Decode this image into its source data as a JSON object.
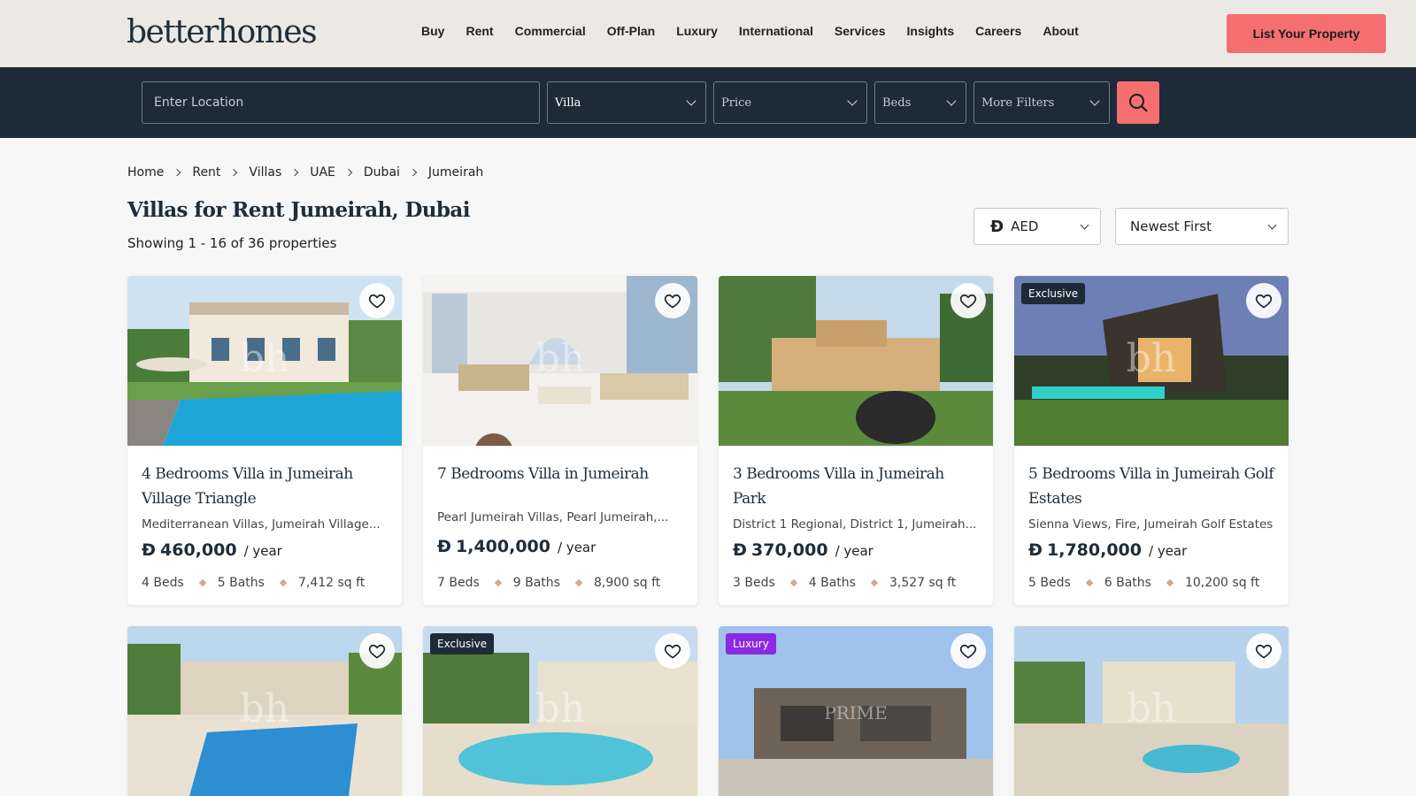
{
  "header": {
    "logo": "betterhomes",
    "nav": [
      "Buy",
      "Rent",
      "Commercial",
      "Off-Plan",
      "Luxury",
      "International",
      "Services",
      "Insights",
      "Careers",
      "About"
    ],
    "cta": "List Your Property"
  },
  "search": {
    "location_placeholder": "Enter Location",
    "type": "Villa",
    "price": "Price",
    "beds": "Beds",
    "more": "More Filters"
  },
  "breadcrumb": [
    "Home",
    "Rent",
    "Villas",
    "UAE",
    "Dubai",
    "Jumeirah"
  ],
  "listing": {
    "title": "Villas for Rent Jumeirah, Dubai",
    "count": "Showing 1 - 16 of 36 properties",
    "currency": "AED",
    "currency_symbol": "Đ",
    "sort": "Newest First"
  },
  "cards": [
    {
      "title": "4 Bedrooms Villa in Jumeirah Village Triangle",
      "location": "Mediterranean Villas, Jumeirah Village...",
      "price": "460,000",
      "per": "/ year",
      "beds": "4 Beds",
      "baths": "5 Baths",
      "area": "7,412 sq ft",
      "badge": "",
      "watermark": "bh"
    },
    {
      "title": "7 Bedrooms Villa in Jumeirah",
      "location": "Pearl Jumeirah Villas, Pearl Jumeirah,...",
      "price": "1,400,000",
      "per": "/ year",
      "beds": "7 Beds",
      "baths": "9 Baths",
      "area": "8,900 sq ft",
      "badge": "",
      "watermark": "bh"
    },
    {
      "title": "3 Bedrooms Villa in Jumeirah Park",
      "location": "District 1 Regional, District 1, Jumeirah...",
      "price": "370,000",
      "per": "/ year",
      "beds": "3 Beds",
      "baths": "4 Baths",
      "area": "3,527 sq ft",
      "badge": "",
      "watermark": ""
    },
    {
      "title": "5 Bedrooms Villa in Jumeirah Golf Estates",
      "location": "Sienna Views, Fire, Jumeirah Golf Estates",
      "price": "1,780,000",
      "per": "/ year",
      "beds": "5 Beds",
      "baths": "6 Baths",
      "area": "10,200 sq ft",
      "badge": "Exclusive",
      "watermark": "bh"
    },
    {
      "badge": "",
      "watermark": "bh"
    },
    {
      "badge": "Exclusive",
      "watermark": "bh"
    },
    {
      "badge": "Luxury",
      "watermark": "PRIME"
    },
    {
      "badge": "",
      "watermark": "bh"
    }
  ],
  "colors": {
    "accent": "#f56f70",
    "navy": "#1d2b38",
    "luxury_badge": "#8a2be2"
  }
}
